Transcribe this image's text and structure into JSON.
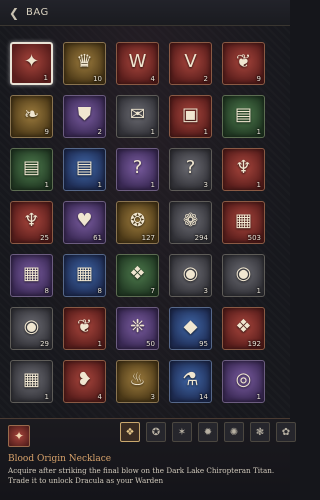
{
  "header": {
    "title": "BAG",
    "back_icon": "back-arrow-icon"
  },
  "slots": [
    {
      "icon": "crest-emblem-icon",
      "glyph": "✦",
      "count": "1",
      "rarity": "r-red",
      "selected": true
    },
    {
      "icon": "crown-emblem-icon",
      "glyph": "♛",
      "count": "10",
      "rarity": "r-gold"
    },
    {
      "icon": "shield-w-icon",
      "glyph": "W",
      "count": "4",
      "rarity": "r-red"
    },
    {
      "icon": "shield-v-icon",
      "glyph": "V",
      "count": "2",
      "rarity": "r-red"
    },
    {
      "icon": "dragon-crest-icon",
      "glyph": "❦",
      "count": "9",
      "rarity": "r-red"
    },
    {
      "icon": "bat-wing-icon",
      "glyph": "❧",
      "count": "9",
      "rarity": "r-gold"
    },
    {
      "icon": "purple-shield-icon",
      "glyph": "⛊",
      "count": "2",
      "rarity": "r-purple"
    },
    {
      "icon": "scroll-icon",
      "glyph": "✉",
      "count": "1",
      "rarity": "r-gray"
    },
    {
      "icon": "red-book-icon",
      "glyph": "▣",
      "count": "1",
      "rarity": "r-red"
    },
    {
      "icon": "green-book-icon",
      "glyph": "▤",
      "count": "1",
      "rarity": "r-green"
    },
    {
      "icon": "green-book-icon",
      "glyph": "▤",
      "count": "1",
      "rarity": "r-green"
    },
    {
      "icon": "blue-book-icon",
      "glyph": "▤",
      "count": "1",
      "rarity": "r-blue"
    },
    {
      "icon": "mystery-book-icon",
      "glyph": "?",
      "count": "1",
      "rarity": "r-purple"
    },
    {
      "icon": "mystery-book-icon",
      "glyph": "?",
      "count": "3",
      "rarity": "r-gray"
    },
    {
      "icon": "goblet-icon",
      "glyph": "♆",
      "count": "1",
      "rarity": "r-red"
    },
    {
      "icon": "potion-goblet-icon",
      "glyph": "♆",
      "count": "25",
      "rarity": "r-red"
    },
    {
      "icon": "purple-heart-icon",
      "glyph": "♥",
      "count": "61",
      "rarity": "r-purple"
    },
    {
      "icon": "gold-coins-icon",
      "glyph": "❂",
      "count": "127",
      "rarity": "r-gold"
    },
    {
      "icon": "mushroom-icon",
      "glyph": "❁",
      "count": "294",
      "rarity": "r-gray"
    },
    {
      "icon": "treasure-chest-icon",
      "glyph": "▦",
      "count": "503",
      "rarity": "r-red"
    },
    {
      "icon": "treasure-chest-icon",
      "glyph": "▦",
      "count": "8",
      "rarity": "r-purple"
    },
    {
      "icon": "blue-chest-icon",
      "glyph": "▦",
      "count": "8",
      "rarity": "r-blue"
    },
    {
      "icon": "green-bag-icon",
      "glyph": "❖",
      "count": "7",
      "rarity": "r-green"
    },
    {
      "icon": "silver-coin-icon",
      "glyph": "◉",
      "count": "3",
      "rarity": "r-gray"
    },
    {
      "icon": "silver-coin-icon",
      "glyph": "◉",
      "count": "1",
      "rarity": "r-gray"
    },
    {
      "icon": "silver-coin-icon",
      "glyph": "◉",
      "count": "29",
      "rarity": "r-gray"
    },
    {
      "icon": "red-wing-charm-icon",
      "glyph": "❦",
      "count": "1",
      "rarity": "r-red"
    },
    {
      "icon": "purple-gem-cluster-icon",
      "glyph": "❈",
      "count": "50",
      "rarity": "r-purple"
    },
    {
      "icon": "blue-gem-icon",
      "glyph": "◆",
      "count": "95",
      "rarity": "r-blue"
    },
    {
      "icon": "red-crystal-icon",
      "glyph": "❖",
      "count": "192",
      "rarity": "r-red"
    },
    {
      "icon": "silver-chest-icon",
      "glyph": "▦",
      "count": "1",
      "rarity": "r-gray"
    },
    {
      "icon": "red-necklace-icon",
      "glyph": "❥",
      "count": "4",
      "rarity": "r-red"
    },
    {
      "icon": "orange-potion-icon",
      "glyph": "♨",
      "count": "3",
      "rarity": "r-gold"
    },
    {
      "icon": "blue-vial-icon",
      "glyph": "⚗",
      "count": "14",
      "rarity": "r-blue"
    },
    {
      "icon": "silver-ring-icon",
      "glyph": "◎",
      "count": "1",
      "rarity": "r-purple"
    }
  ],
  "tabs": [
    {
      "icon": "all-items-tab-icon",
      "glyph": "❖",
      "active": true
    },
    {
      "icon": "gear-tab-icon",
      "glyph": "✪"
    },
    {
      "icon": "crest-tab-icon",
      "glyph": "✶"
    },
    {
      "icon": "mask-tab-icon",
      "glyph": "✹"
    },
    {
      "icon": "coins-tab-icon",
      "glyph": "✺"
    },
    {
      "icon": "wing-tab-icon",
      "glyph": "❃"
    },
    {
      "icon": "cloak-tab-icon",
      "glyph": "✿"
    }
  ],
  "selected_item": {
    "icon": "crest-emblem-icon",
    "glyph": "✦",
    "name": "Blood Origin Necklace",
    "description": "Acquire after striking the final blow on the Dark Lake Chiropteran Titan. Trade it to unlock Dracula as your Warden"
  }
}
